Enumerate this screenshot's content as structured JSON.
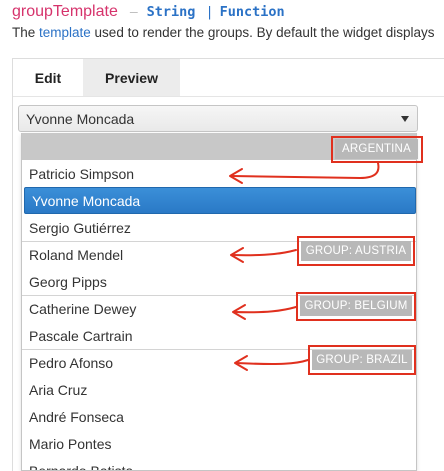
{
  "header": {
    "prop_name": "groupTemplate",
    "dash": "–",
    "type_string": "String",
    "separator": "|",
    "type_function": "Function"
  },
  "description": {
    "prefix": "The ",
    "link": "template",
    "suffix": " used to render the groups. By default the widget displays"
  },
  "tabs": [
    {
      "label": "Edit",
      "active": true
    },
    {
      "label": "Preview",
      "active": false
    }
  ],
  "dropdown": {
    "selected_value": "Yvonne Moncada",
    "items": [
      "Patricio Simpson",
      "Yvonne Moncada",
      "Sergio Gutiérrez",
      "Roland Mendel",
      "Georg Pipps",
      "Catherine Dewey",
      "Pascale Cartrain",
      "Pedro Afonso",
      "Aria Cruz",
      "André Fonseca",
      "Mario Pontes",
      "Bernardo Batista"
    ],
    "group_labels": {
      "argentina": "ARGENTINA",
      "austria": "GROUP: AUSTRIA",
      "belgium": "GROUP: BELGIUM",
      "brazil": "GROUP: BRAZIL"
    }
  },
  "annotation": {
    "color": "#e0301e"
  }
}
